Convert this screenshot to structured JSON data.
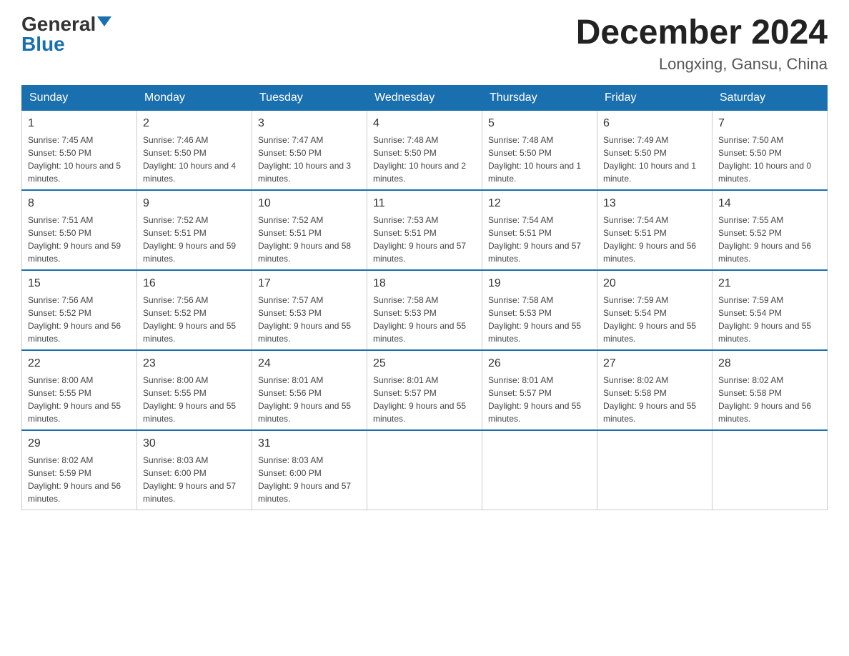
{
  "header": {
    "logo_general": "General",
    "logo_blue": "Blue",
    "title": "December 2024",
    "location": "Longxing, Gansu, China"
  },
  "days_of_week": [
    "Sunday",
    "Monday",
    "Tuesday",
    "Wednesday",
    "Thursday",
    "Friday",
    "Saturday"
  ],
  "weeks": [
    [
      {
        "day": "1",
        "sunrise": "7:45 AM",
        "sunset": "5:50 PM",
        "daylight": "10 hours and 5 minutes."
      },
      {
        "day": "2",
        "sunrise": "7:46 AM",
        "sunset": "5:50 PM",
        "daylight": "10 hours and 4 minutes."
      },
      {
        "day": "3",
        "sunrise": "7:47 AM",
        "sunset": "5:50 PM",
        "daylight": "10 hours and 3 minutes."
      },
      {
        "day": "4",
        "sunrise": "7:48 AM",
        "sunset": "5:50 PM",
        "daylight": "10 hours and 2 minutes."
      },
      {
        "day": "5",
        "sunrise": "7:48 AM",
        "sunset": "5:50 PM",
        "daylight": "10 hours and 1 minute."
      },
      {
        "day": "6",
        "sunrise": "7:49 AM",
        "sunset": "5:50 PM",
        "daylight": "10 hours and 1 minute."
      },
      {
        "day": "7",
        "sunrise": "7:50 AM",
        "sunset": "5:50 PM",
        "daylight": "10 hours and 0 minutes."
      }
    ],
    [
      {
        "day": "8",
        "sunrise": "7:51 AM",
        "sunset": "5:50 PM",
        "daylight": "9 hours and 59 minutes."
      },
      {
        "day": "9",
        "sunrise": "7:52 AM",
        "sunset": "5:51 PM",
        "daylight": "9 hours and 59 minutes."
      },
      {
        "day": "10",
        "sunrise": "7:52 AM",
        "sunset": "5:51 PM",
        "daylight": "9 hours and 58 minutes."
      },
      {
        "day": "11",
        "sunrise": "7:53 AM",
        "sunset": "5:51 PM",
        "daylight": "9 hours and 57 minutes."
      },
      {
        "day": "12",
        "sunrise": "7:54 AM",
        "sunset": "5:51 PM",
        "daylight": "9 hours and 57 minutes."
      },
      {
        "day": "13",
        "sunrise": "7:54 AM",
        "sunset": "5:51 PM",
        "daylight": "9 hours and 56 minutes."
      },
      {
        "day": "14",
        "sunrise": "7:55 AM",
        "sunset": "5:52 PM",
        "daylight": "9 hours and 56 minutes."
      }
    ],
    [
      {
        "day": "15",
        "sunrise": "7:56 AM",
        "sunset": "5:52 PM",
        "daylight": "9 hours and 56 minutes."
      },
      {
        "day": "16",
        "sunrise": "7:56 AM",
        "sunset": "5:52 PM",
        "daylight": "9 hours and 55 minutes."
      },
      {
        "day": "17",
        "sunrise": "7:57 AM",
        "sunset": "5:53 PM",
        "daylight": "9 hours and 55 minutes."
      },
      {
        "day": "18",
        "sunrise": "7:58 AM",
        "sunset": "5:53 PM",
        "daylight": "9 hours and 55 minutes."
      },
      {
        "day": "19",
        "sunrise": "7:58 AM",
        "sunset": "5:53 PM",
        "daylight": "9 hours and 55 minutes."
      },
      {
        "day": "20",
        "sunrise": "7:59 AM",
        "sunset": "5:54 PM",
        "daylight": "9 hours and 55 minutes."
      },
      {
        "day": "21",
        "sunrise": "7:59 AM",
        "sunset": "5:54 PM",
        "daylight": "9 hours and 55 minutes."
      }
    ],
    [
      {
        "day": "22",
        "sunrise": "8:00 AM",
        "sunset": "5:55 PM",
        "daylight": "9 hours and 55 minutes."
      },
      {
        "day": "23",
        "sunrise": "8:00 AM",
        "sunset": "5:55 PM",
        "daylight": "9 hours and 55 minutes."
      },
      {
        "day": "24",
        "sunrise": "8:01 AM",
        "sunset": "5:56 PM",
        "daylight": "9 hours and 55 minutes."
      },
      {
        "day": "25",
        "sunrise": "8:01 AM",
        "sunset": "5:57 PM",
        "daylight": "9 hours and 55 minutes."
      },
      {
        "day": "26",
        "sunrise": "8:01 AM",
        "sunset": "5:57 PM",
        "daylight": "9 hours and 55 minutes."
      },
      {
        "day": "27",
        "sunrise": "8:02 AM",
        "sunset": "5:58 PM",
        "daylight": "9 hours and 55 minutes."
      },
      {
        "day": "28",
        "sunrise": "8:02 AM",
        "sunset": "5:58 PM",
        "daylight": "9 hours and 56 minutes."
      }
    ],
    [
      {
        "day": "29",
        "sunrise": "8:02 AM",
        "sunset": "5:59 PM",
        "daylight": "9 hours and 56 minutes."
      },
      {
        "day": "30",
        "sunrise": "8:03 AM",
        "sunset": "6:00 PM",
        "daylight": "9 hours and 57 minutes."
      },
      {
        "day": "31",
        "sunrise": "8:03 AM",
        "sunset": "6:00 PM",
        "daylight": "9 hours and 57 minutes."
      },
      null,
      null,
      null,
      null
    ]
  ]
}
